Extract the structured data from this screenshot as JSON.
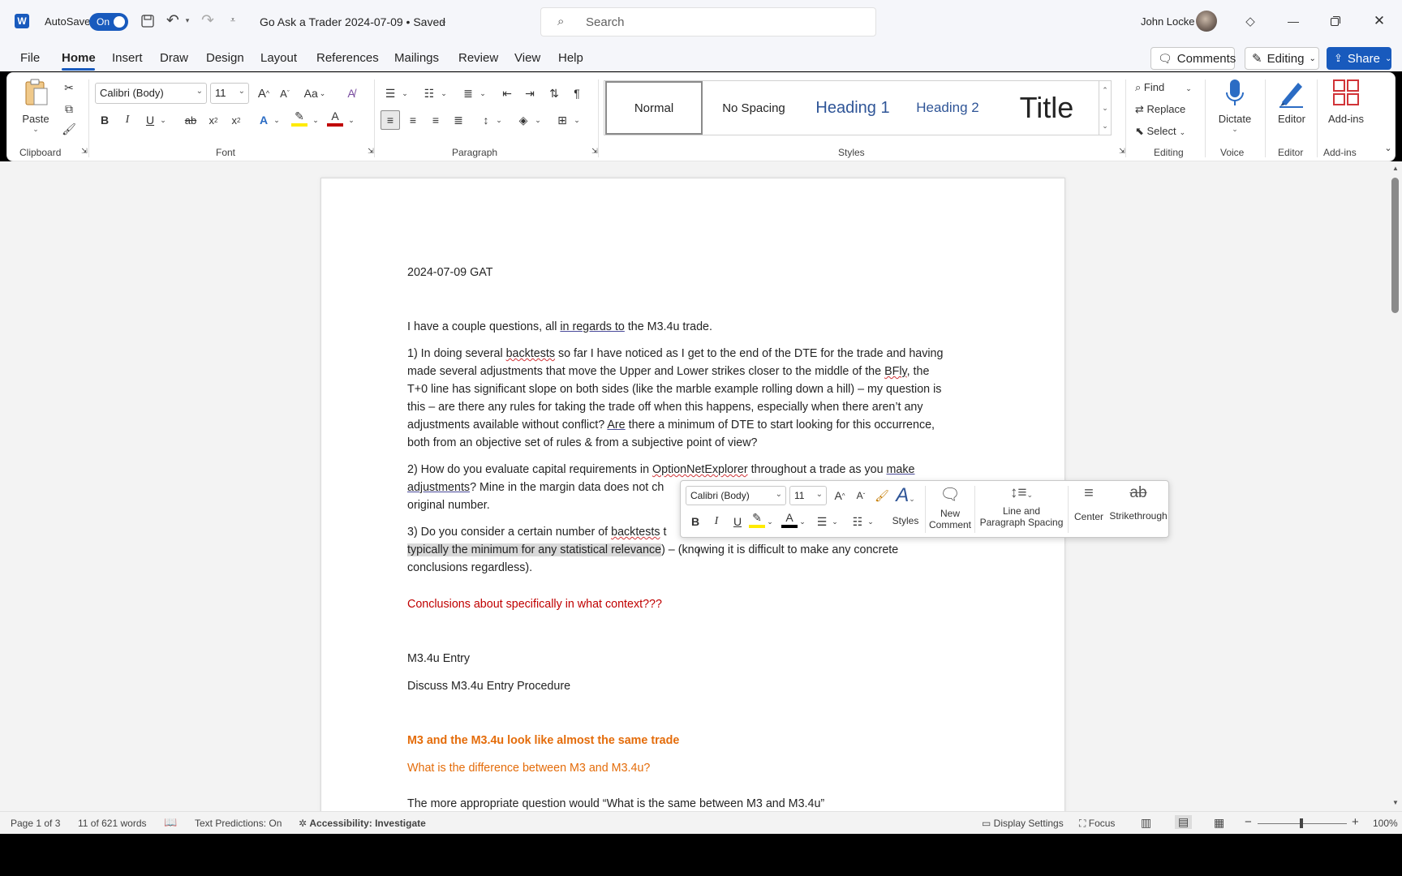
{
  "titlebar": {
    "app_icon": "word-icon",
    "autosave_label": "AutoSave",
    "autosave_state": "On",
    "doc_title": "Go Ask a Trader 2024-07-09 • Saved",
    "search_placeholder": "Search",
    "user_name": "John Locke"
  },
  "tabs": [
    "File",
    "Home",
    "Insert",
    "Draw",
    "Design",
    "Layout",
    "References",
    "Mailings",
    "Review",
    "View",
    "Help"
  ],
  "actions": {
    "comments": "Comments",
    "editing": "Editing",
    "share": "Share"
  },
  "ribbon": {
    "clipboard": {
      "paste": "Paste",
      "group": "Clipboard"
    },
    "font": {
      "name": "Calibri (Body)",
      "size": "11",
      "group": "Font",
      "change_case": "Aa"
    },
    "paragraph": {
      "group": "Paragraph"
    },
    "styles": {
      "items": [
        "Normal",
        "No Spacing",
        "Heading 1",
        "Heading 2",
        "Title"
      ],
      "group": "Styles"
    },
    "editing": {
      "find": "Find",
      "replace": "Replace",
      "select": "Select",
      "group": "Editing"
    },
    "voice": {
      "dictate": "Dictate",
      "group": "Voice"
    },
    "editor": {
      "label": "Editor",
      "group": "Editor"
    },
    "addins": {
      "label": "Add-ins",
      "group": "Add-ins"
    }
  },
  "document": {
    "date_line": "2024-07-09 GAT",
    "intro": {
      "a": "I have a couple questions, all ",
      "b": "in regards to",
      "c": " the M3.4u trade."
    },
    "q1": [
      {
        "a": "1) In doing several ",
        "b": "backtests",
        "c": " so far I have noticed as I get to the end of the DTE for the trade and having"
      },
      {
        "a": "made several adjustments that move the Upper and Lower strikes closer to the middle of the ",
        "b": "BFly",
        "c": ", the"
      },
      {
        "a": "T+0 line has significant slope on both sides (like the marble example rolling down a hill) – my question is"
      },
      {
        "a": "this – are there any rules for taking the trade off when this happens, especially when there aren’t any"
      },
      {
        "a": "adjustments available without conflict? ",
        "b": "Are",
        "c": " there a minimum of DTE to start looking for this occurrence,"
      },
      {
        "a": "both from an objective set of rules & from a subjective point of view?"
      }
    ],
    "q2": [
      {
        "a": "2) How do you evaluate capital requirements in ",
        "b": "OptionNetExplorer",
        "c": " throughout a trade as you ",
        "d": "make"
      },
      {
        "a": "adjustments",
        "b": "? Mine in the margin data does not ch"
      },
      {
        "a": "original number."
      }
    ],
    "q3": [
      {
        "a": "3) Do you consider a certain number of ",
        "b": "backtests",
        "c": " t"
      },
      {
        "a": "typically the minimum for any statistical relevance",
        "b": ") – (knowing it is difficult to make any concrete"
      },
      {
        "a": "conclusions regardless)."
      }
    ],
    "red_note": "Conclusions about specifically in what context???",
    "entry_title": "M3.4u Entry",
    "entry_sub": "Discuss M3.4u Entry Procedure",
    "orange1": "M3 and the M3.4u look like almost the same trade",
    "orange2": "What is the difference between M3 and M3.4u?",
    "last_line": "The more appropriate question would “What is the same between M3 and M3.4u”"
  },
  "floatie": {
    "font": "Calibri (Body)",
    "size": "11",
    "styles": "Styles",
    "new_comment": [
      "New",
      "Comment"
    ],
    "line_spacing": [
      "Line and",
      "Paragraph Spacing"
    ],
    "center": "Center",
    "strikethrough": "Strikethrough",
    "strike_glyph": "ab"
  },
  "status": {
    "page": "Page 1 of 3",
    "words": "11 of 621 words",
    "text_predictions": "Text Predictions: On",
    "accessibility": "Accessibility: Investigate",
    "display_settings": "Display Settings",
    "focus": "Focus",
    "zoom": "100%"
  },
  "colors": {
    "accent": "#185abd",
    "red_text": "#c00000",
    "orange_text": "#e46c0a"
  }
}
